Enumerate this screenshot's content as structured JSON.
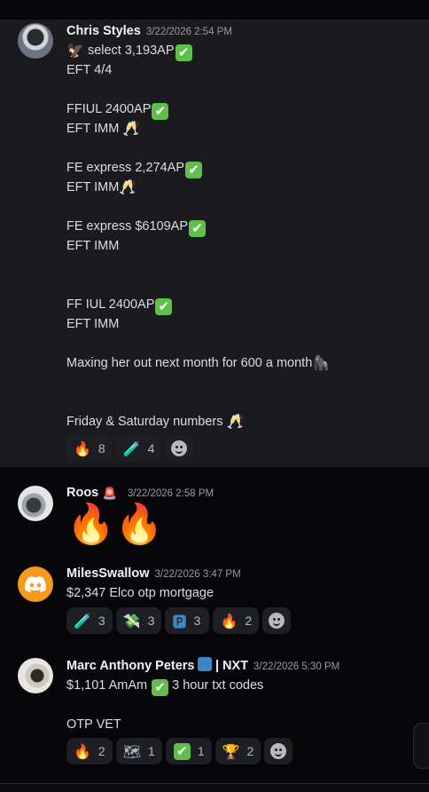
{
  "messages": [
    {
      "author": "Chris Styles",
      "timestamp": "3/22/2026 2:54 PM",
      "lines": [
        "select 3,193AP",
        "EFT 4/4",
        "FFIUL 2400AP",
        "EFT IMM",
        "FE express 2,274AP",
        "EFT IMM",
        "FE express $6109AP",
        "EFT IMM",
        "FF IUL 2400AP",
        "EFT IMM",
        "Maxing her out next month for 600 a month",
        "Friday & Saturday numbers"
      ],
      "reactions": [
        {
          "icon": "fire",
          "glyph": "🔥",
          "count": "8"
        },
        {
          "icon": "test-tube",
          "glyph": "🧪",
          "count": "4"
        }
      ]
    },
    {
      "author": "Roos",
      "timestamp": "3/22/2026 2:58 PM",
      "big_emoji": "🔥🔥"
    },
    {
      "author": "MilesSwallow",
      "timestamp": "3/22/2026 3:47 PM",
      "lines": [
        "$2,347 Elco otp mortgage"
      ],
      "reactions": [
        {
          "icon": "test-tube",
          "glyph": "🧪",
          "count": "3"
        },
        {
          "icon": "money-wings",
          "glyph": "💸",
          "count": "3"
        },
        {
          "icon": "parking-p",
          "glyph": "🅿",
          "count": "3"
        },
        {
          "icon": "fire",
          "glyph": "🔥",
          "count": "2"
        }
      ]
    },
    {
      "author": "Marc Anthony Peters",
      "author_suffix": "| NXT",
      "timestamp": "3/22/2026 5:30 PM",
      "lines": [
        "$1,101 AmAm",
        "3 hour txt codes",
        "OTP VET"
      ],
      "reactions": [
        {
          "icon": "fire",
          "glyph": "🔥",
          "count": "2"
        },
        {
          "icon": "map",
          "glyph": "🗺",
          "count": "1"
        },
        {
          "icon": "check",
          "glyph": "✔",
          "count": "1"
        },
        {
          "icon": "trophy",
          "glyph": "🏆",
          "count": "2"
        }
      ]
    }
  ],
  "glyphs": {
    "check": "✔",
    "cheers": "🥂",
    "eagle": "🦅",
    "gorilla": "🦍",
    "siren": "🚨"
  },
  "colors": {
    "background": "#070709",
    "highlight": "#1b1b1f",
    "check_green": "#5fbf4a",
    "reaction_bg": "#1e1f24"
  }
}
